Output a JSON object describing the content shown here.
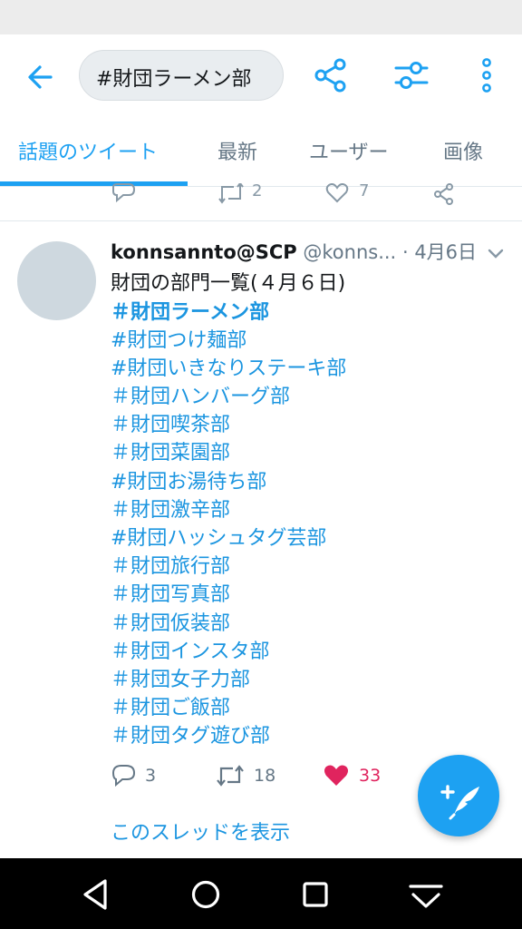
{
  "search": {
    "query": "#財団ラーメン部"
  },
  "tabs": [
    {
      "label": "話題のツイート",
      "active": true
    },
    {
      "label": "最新",
      "active": false
    },
    {
      "label": "ユーザー",
      "active": false
    },
    {
      "label": "画像",
      "active": false
    }
  ],
  "previous_tweet": {
    "retweets": "2",
    "likes": "7"
  },
  "tweet": {
    "author_name": "konnsannto@SCP",
    "handle": "@konns...",
    "separator": "·",
    "date": "4月6日",
    "text_first_line": "財団の部門一覧(４月６日)",
    "hashtags": [
      "＃財団ラーメン部",
      "#財団つけ麺部",
      "#財団いきなりステーキ部",
      "＃財団ハンバーグ部",
      "＃財団喫茶部",
      "＃財団菜園部",
      "#財団お湯待ち部",
      "＃財団激辛部",
      "#財団ハッシュタグ芸部",
      "＃財団旅行部",
      "＃財団写真部",
      "＃財団仮装部",
      "＃財団インスタ部",
      "＃財団女子力部",
      "＃財団ご飯部",
      "＃財団タグ遊び部"
    ],
    "replies": "3",
    "retweets": "18",
    "likes": "33",
    "show_thread": "このスレッドを表示"
  },
  "colors": {
    "accent": "#1da1f2",
    "link": "#1b95e0",
    "like": "#e0245e",
    "muted": "#657786"
  }
}
